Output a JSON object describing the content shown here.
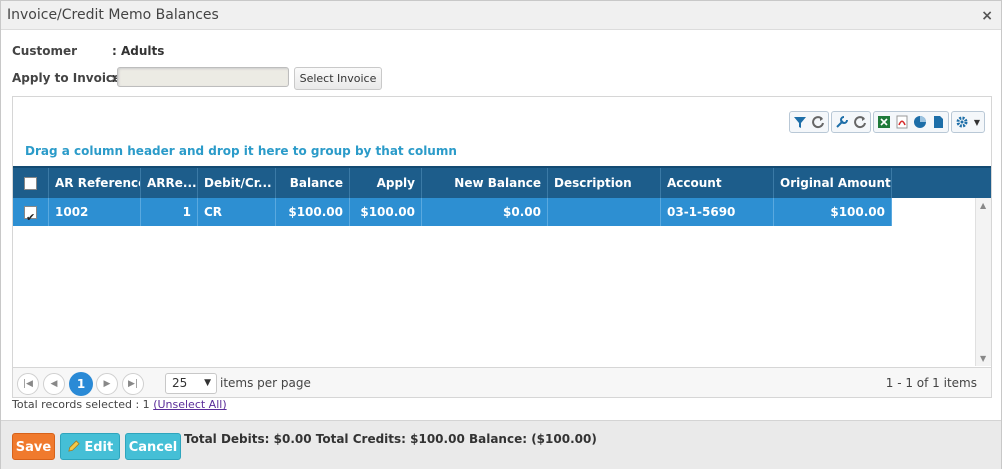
{
  "window": {
    "title": "Invoice/Credit Memo Balances",
    "close_label": "×"
  },
  "form": {
    "customer_label": "Customer",
    "customer_value": ": Adults",
    "apply_label": "Apply to Invoice",
    "apply_value": "",
    "select_button": "Select Invoice"
  },
  "grid": {
    "group_hint": "Drag a column header and drop it here to group by that column",
    "toolbar_icons": [
      "filter-icon",
      "refresh-icon",
      "wrench-icon",
      "reset-icon",
      "excel-icon",
      "pdf-icon",
      "chart-icon",
      "document-icon",
      "gear-icon"
    ],
    "columns": [
      "AR Reference",
      "ARRe...",
      "Debit/Cr...",
      "Balance",
      "Apply",
      "New Balance",
      "Description",
      "Account",
      "Original Amount"
    ],
    "rows": [
      {
        "checked": true,
        "ar_reference": "1002",
        "arre": "1",
        "debit_credit": "CR",
        "balance": "$100.00",
        "apply": "$100.00",
        "new_balance": "$0.00",
        "description": "",
        "account": "03-1-5690",
        "original_amount": "$100.00"
      }
    ],
    "pager": {
      "current_page": "1",
      "page_size": "25",
      "items_per_page_label": "items per page",
      "info": "1 - 1 of 1 items"
    }
  },
  "selection": {
    "text": "Total records selected : 1 ",
    "link": "(Unselect All)"
  },
  "footer": {
    "save": "Save",
    "edit": "Edit",
    "cancel": "Cancel",
    "totals": "Total Debits: $0.00 Total Credits: $100.00 Balance: ($100.00)"
  },
  "colors": {
    "header_bg": "#1d5d8b",
    "selected_row": "#2d8fd2",
    "save_button": "#f07a2d",
    "action_button": "#45bfd6",
    "hint_text": "#2b9bc9"
  }
}
